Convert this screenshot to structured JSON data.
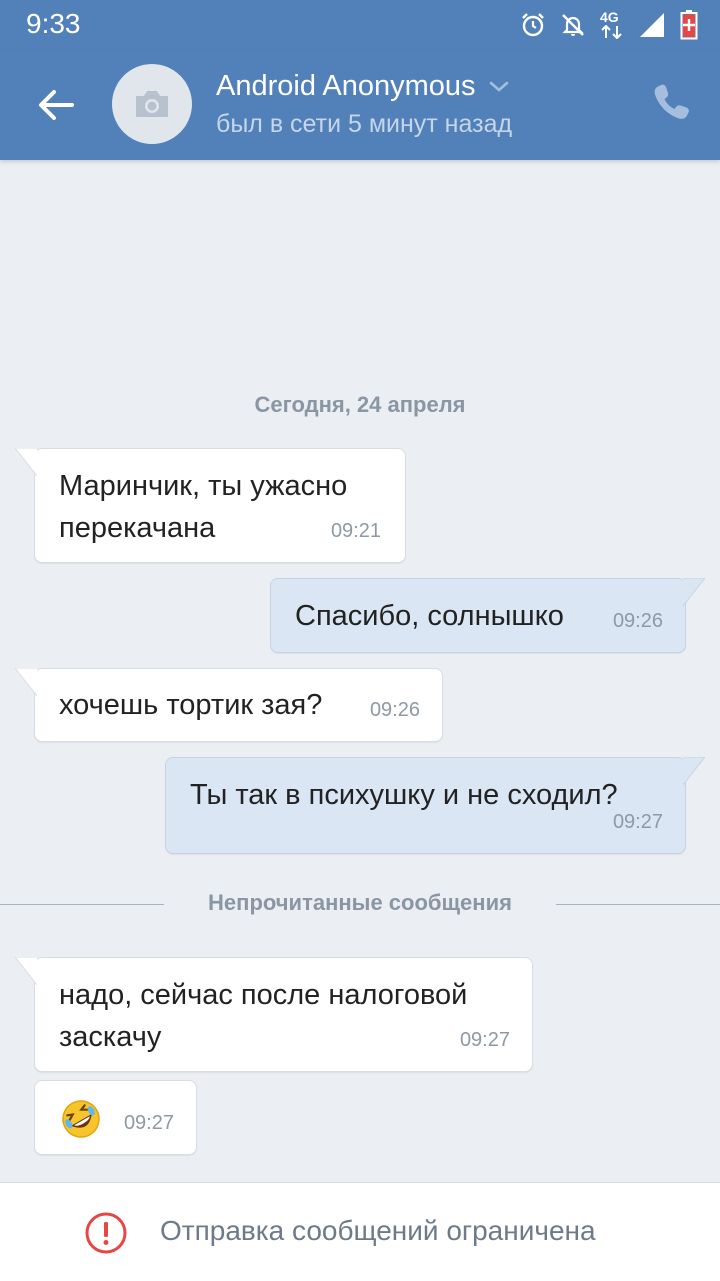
{
  "status_bar": {
    "time": "9:33",
    "network": "4G",
    "icons": [
      "alarm-icon",
      "notifications-off-icon",
      "network-4g-icon",
      "signal-icon",
      "battery-low-icon"
    ]
  },
  "header": {
    "contact_name": "Android Anonymous",
    "contact_status": "был в сети 5 минут назад",
    "icons": [
      "back-arrow-icon",
      "camera-icon",
      "chevron-down-icon",
      "phone-icon"
    ]
  },
  "chat": {
    "date_separator": "Сегодня, 24 апреля",
    "unread_separator": "Непрочитанные сообщения",
    "messages": [
      {
        "direction": "in",
        "text_line1": "Маринчик, ты ужасно",
        "text_line2": "перекачана",
        "time": "09:21"
      },
      {
        "direction": "out",
        "text": "Спасибо, солнышко",
        "time": "09:26"
      },
      {
        "direction": "in",
        "text": "хочешь тортик зая?",
        "time": "09:26"
      },
      {
        "direction": "out",
        "text": "Ты так в психушку и не сходил?",
        "time": "09:27"
      },
      {
        "direction": "in",
        "text_line1": "надо, сейчас после налоговой",
        "text_line2": "заскачу",
        "time": "09:27"
      },
      {
        "direction": "in",
        "emoji": "rolling-on-floor-laughing",
        "time": "09:27"
      }
    ]
  },
  "footer": {
    "notice": "Отправка сообщений ограничена",
    "icon": "warning-icon"
  },
  "colors": {
    "header_bg": "#5181b8",
    "chat_bg": "#ebeef3",
    "incoming_bubble": "#ffffff",
    "outgoing_bubble": "#dbe6f5",
    "warning_red": "#e64646"
  }
}
